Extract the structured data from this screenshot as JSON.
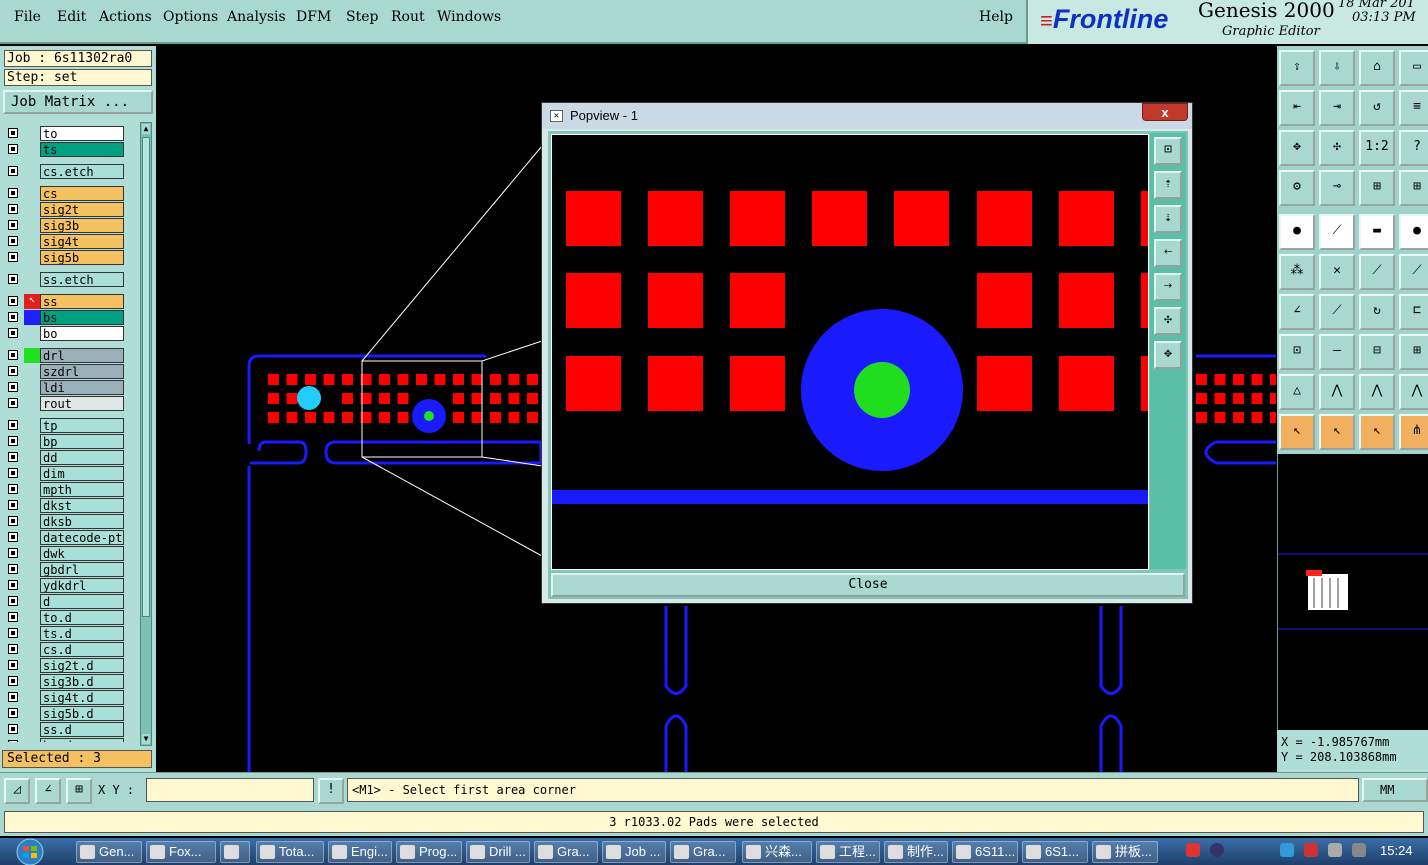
{
  "menu": [
    "File",
    "Edit",
    "Actions",
    "Options",
    "Analysis",
    "DFM",
    "Step",
    "Rout",
    "Windows"
  ],
  "help": "Help",
  "brand": {
    "logo": "Frontline",
    "product": "Genesis 2000",
    "subtitle": "Graphic Editor",
    "date": "18 Mar 201",
    "time": "03:13 PM"
  },
  "job": "Job : 6s11302ra0",
  "step": "Step: set",
  "job_matrix": "Job Matrix ...",
  "layers": [
    {
      "name": "to",
      "color": "#ffffff"
    },
    {
      "name": "ts",
      "color": "#00a080"
    },
    {
      "name": "cs.etch",
      "color": "#a8e0d8",
      "gap": true
    },
    {
      "name": "cs",
      "color": "#f4c060",
      "gap": true
    },
    {
      "name": "sig2t",
      "color": "#f4c060"
    },
    {
      "name": "sig3b",
      "color": "#f4c060"
    },
    {
      "name": "sig4t",
      "color": "#f4c060"
    },
    {
      "name": "sig5b",
      "color": "#f4c060"
    },
    {
      "name": "ss.etch",
      "color": "#a8e0d8",
      "gap": true
    },
    {
      "name": "ss",
      "color": "#f4c060",
      "gap": true,
      "swatch": "#ffffff",
      "active": true
    },
    {
      "name": "bs",
      "color": "#00a080",
      "swatch": "#2020ff"
    },
    {
      "name": "bo",
      "color": "#ffffff"
    },
    {
      "name": "drl",
      "color": "#9ab0b8",
      "gap": true,
      "swatch": "#20e020"
    },
    {
      "name": "szdrl",
      "color": "#9ab0b8"
    },
    {
      "name": "ldi",
      "color": "#9ab0b8"
    },
    {
      "name": "rout",
      "color": "#dde8e6"
    },
    {
      "name": "tp",
      "color": "#a8e0d8",
      "gap": true
    },
    {
      "name": "bp",
      "color": "#a8e0d8"
    },
    {
      "name": "dd",
      "color": "#a8e0d8"
    },
    {
      "name": "dim",
      "color": "#a8e0d8"
    },
    {
      "name": "mpth",
      "color": "#a8e0d8"
    },
    {
      "name": "dkst",
      "color": "#a8e0d8"
    },
    {
      "name": "dksb",
      "color": "#a8e0d8"
    },
    {
      "name": "datecode-ptc",
      "color": "#a8e0d8"
    },
    {
      "name": "dwk",
      "color": "#a8e0d8"
    },
    {
      "name": "gbdrl",
      "color": "#a8e0d8"
    },
    {
      "name": "ydkdrl",
      "color": "#a8e0d8"
    },
    {
      "name": "d",
      "color": "#a8e0d8"
    },
    {
      "name": "to.d",
      "color": "#a8e0d8"
    },
    {
      "name": "ts.d",
      "color": "#a8e0d8"
    },
    {
      "name": "cs.d",
      "color": "#a8e0d8"
    },
    {
      "name": "sig2t.d",
      "color": "#a8e0d8"
    },
    {
      "name": "sig3b.d",
      "color": "#a8e0d8"
    },
    {
      "name": "sig4t.d",
      "color": "#a8e0d8"
    },
    {
      "name": "sig5b.d",
      "color": "#a8e0d8"
    },
    {
      "name": "ss.d",
      "color": "#a8e0d8"
    },
    {
      "name": "bs.d",
      "color": "#a8e0d8"
    }
  ],
  "selected": "Selected : 3",
  "popview": {
    "title": "Popview - 1",
    "close_x": "x",
    "close": "Close"
  },
  "coords": {
    "x": "X = -1.985767mm",
    "y": "Y = 208.103868mm"
  },
  "xy_label": "X Y :",
  "xy_value": "",
  "prompt": "<M1> - Select first area corner",
  "units": "MM",
  "status": "3 r1033.02 Pads were selected",
  "taskbar": [
    "Gen...",
    "Fox...",
    "",
    "Tota...",
    "Engi...",
    "Prog...",
    "Drill ...",
    "Gra...",
    "Job ...",
    "Gra...",
    "兴森...",
    "工程...",
    "制作...",
    "6S11...",
    "6S1...",
    "拼板..."
  ],
  "clock": "15:24",
  "colors": {
    "pad": "#ff0000",
    "circle": "#1a1aff",
    "drill": "#20dd20",
    "outline": "#1a1aff",
    "panel": "#a8d8d0"
  }
}
